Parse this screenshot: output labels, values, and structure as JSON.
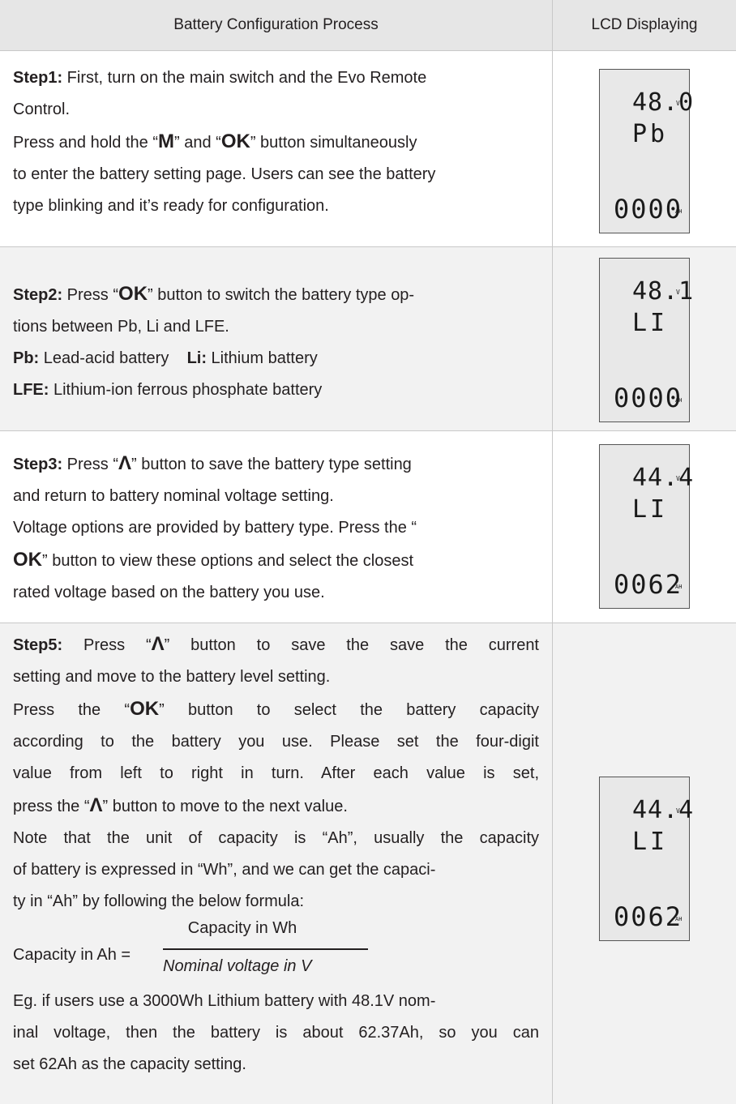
{
  "header": {
    "process": "Battery Configuration Process",
    "lcd": "LCD Displaying"
  },
  "step1": {
    "title": "Step1:",
    "l1": " First, turn on the main switch and the Evo Remote",
    "l2": "Control.",
    "l3a": "Press and hold the “",
    "k1": "M",
    "l3b": "” and “",
    "k2": "OK",
    "l3c": "” button simultaneously",
    "l4": "to enter the battery setting page. Users can see the battery",
    "l5": "type blinking and it’s ready for configuration.",
    "lcd": {
      "v1": "48.0",
      "u1": "V",
      "t2": "Pb",
      "v3": "0000",
      "u3": "AH"
    }
  },
  "step2": {
    "title": "Step2:",
    "l1a": " Press “",
    "k1": "OK",
    "l1b": "”  button to switch the battery type op-",
    "l2": "tions between Pb, Li and LFE.",
    "pb_label": "Pb:",
    "pb_text": " Lead-acid battery",
    "li_label": "Li:",
    "li_text": " Lithium battery",
    "lfe_label": "LFE:",
    "lfe_text": " Lithium-ion ferrous phosphate battery",
    "lcd": {
      "v1": "48.1",
      "u1": "V",
      "t2": "LI",
      "v3": "0000",
      "u3": "AH"
    }
  },
  "step3": {
    "title": "Step3:",
    "l1a": " Press “",
    "k1": "Λ",
    "l1b": "” button to save the battery type setting",
    "l2": "and return to battery nominal voltage setting.",
    "l3": "Voltage options are provided by battery type. Press the “",
    "k2": "OK",
    "l4": "” button to view these options and select the closest",
    "l5": "rated voltage based on the battery you use.",
    "lcd": {
      "v1": "44.4",
      "u1": "V",
      "t2": "LI",
      "v3": "0062",
      "u3": "AH"
    }
  },
  "step5": {
    "title": "Step5:",
    "l1a": " Press “",
    "k1": "Λ",
    "l1b": "” button to save the save the current",
    "l2": "setting and move to the battery level setting.",
    "l3a": "Press the “",
    "k2": "OK",
    "l3b": "”  button to select the battery capacity",
    "l4": "according to the battery you use. Please set the four-digit",
    "l5": "value from left to right in turn. After each value is set,",
    "l6a": "press the “",
    "k3": "Λ",
    "l6b": "” button to move to the next value.",
    "l7": "Note that the unit of capacity is “Ah”, usually the capacity",
    "l8": "of battery is expressed in “Wh”, and we can get the capaci-",
    "l9": "ty in “Ah” by following the below formula:",
    "formula_numerator": "Capacity in Wh",
    "formula_label": "Capacity in Ah  =",
    "formula_denominator": "Nominal voltage in V",
    "l10": "Eg. if users use a 3000Wh Lithium battery with  48.1V nom-",
    "l11": "inal voltage, then the battery is about 62.37Ah, so you can",
    "l12": "set 62Ah as the capacity setting.",
    "lcd": {
      "v1": "44.4",
      "u1": "V",
      "t2": "LI",
      "v3": "0062",
      "u3": "AH"
    }
  }
}
